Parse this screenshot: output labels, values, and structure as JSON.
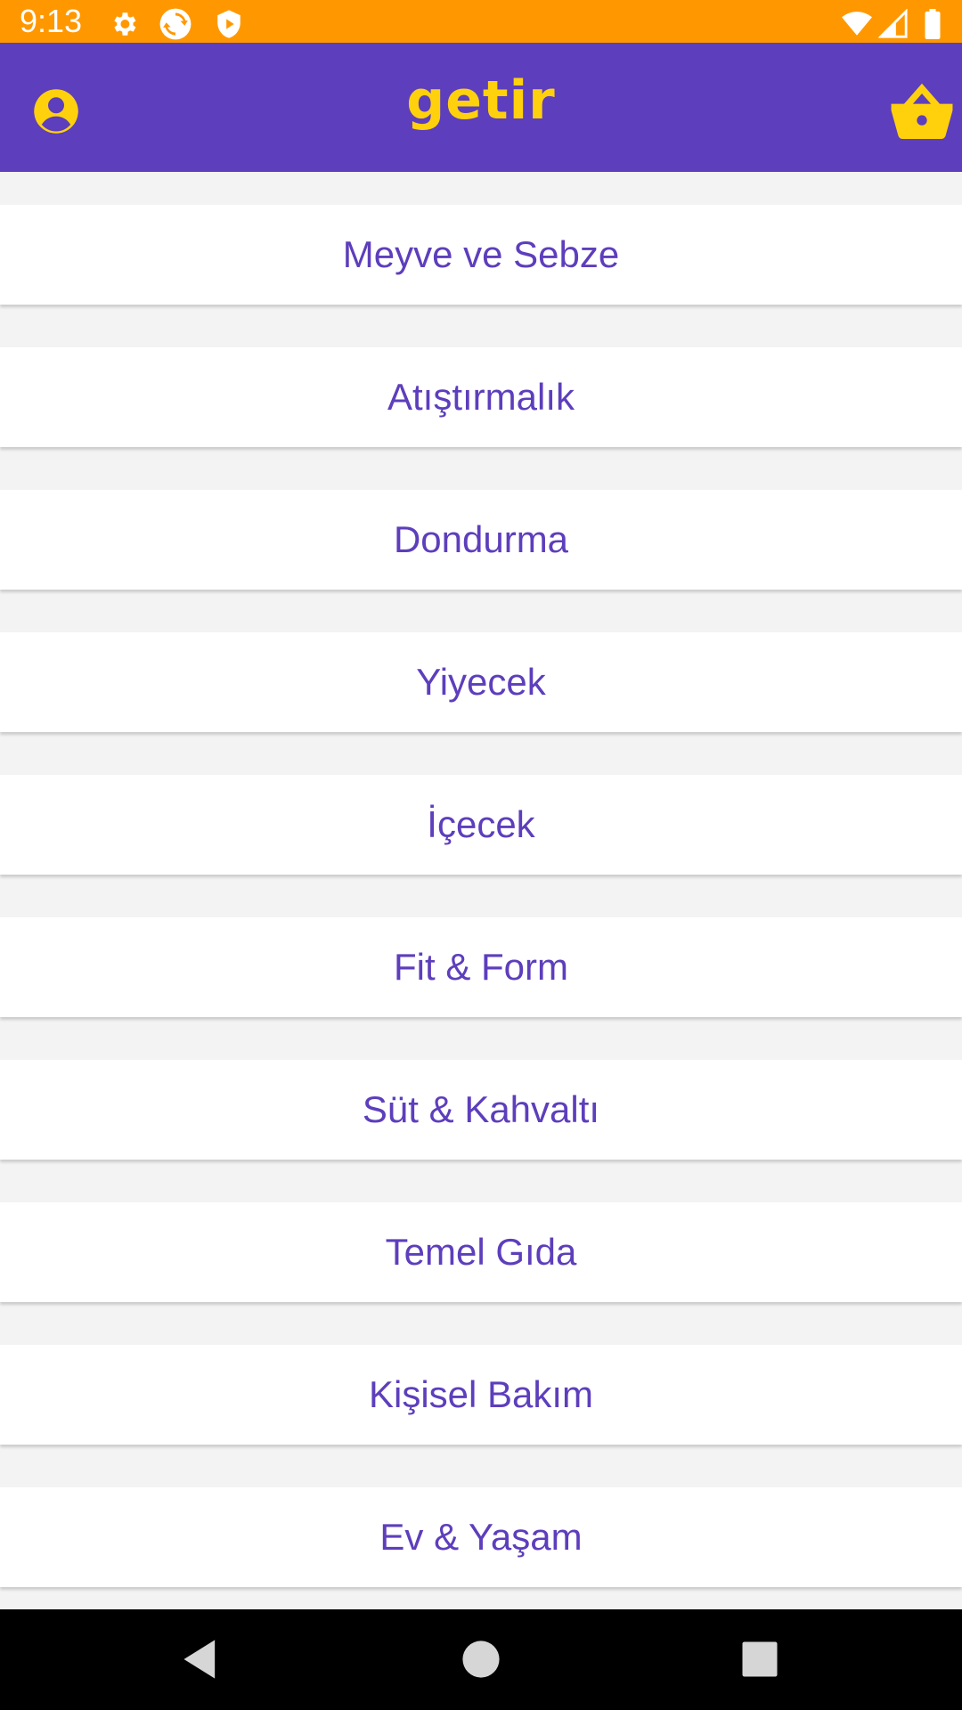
{
  "status_bar": {
    "time": "9:13",
    "background": "#ff9800",
    "left_icons": [
      "settings-icon",
      "sync-icon",
      "play-protect-icon"
    ],
    "right_icons": [
      "wifi-icon",
      "cell-signal-icon",
      "battery-icon"
    ]
  },
  "app_bar": {
    "logo_text": "getir",
    "background": "#5d3ebc",
    "accent": "#ffd10d",
    "left_icon": "profile-icon",
    "right_icon": "basket-icon"
  },
  "categories": [
    {
      "label": "Meyve ve Sebze"
    },
    {
      "label": "Atıştırmalık"
    },
    {
      "label": "Dondurma"
    },
    {
      "label": "Yiyecek"
    },
    {
      "label": "İçecek"
    },
    {
      "label": "Fit & Form"
    },
    {
      "label": "Süt & Kahvaltı"
    },
    {
      "label": "Temel Gıda"
    },
    {
      "label": "Kişisel Bakım"
    },
    {
      "label": "Ev & Yaşam"
    }
  ],
  "nav_bar": {
    "buttons": [
      "back-icon",
      "home-icon",
      "recents-icon"
    ]
  }
}
